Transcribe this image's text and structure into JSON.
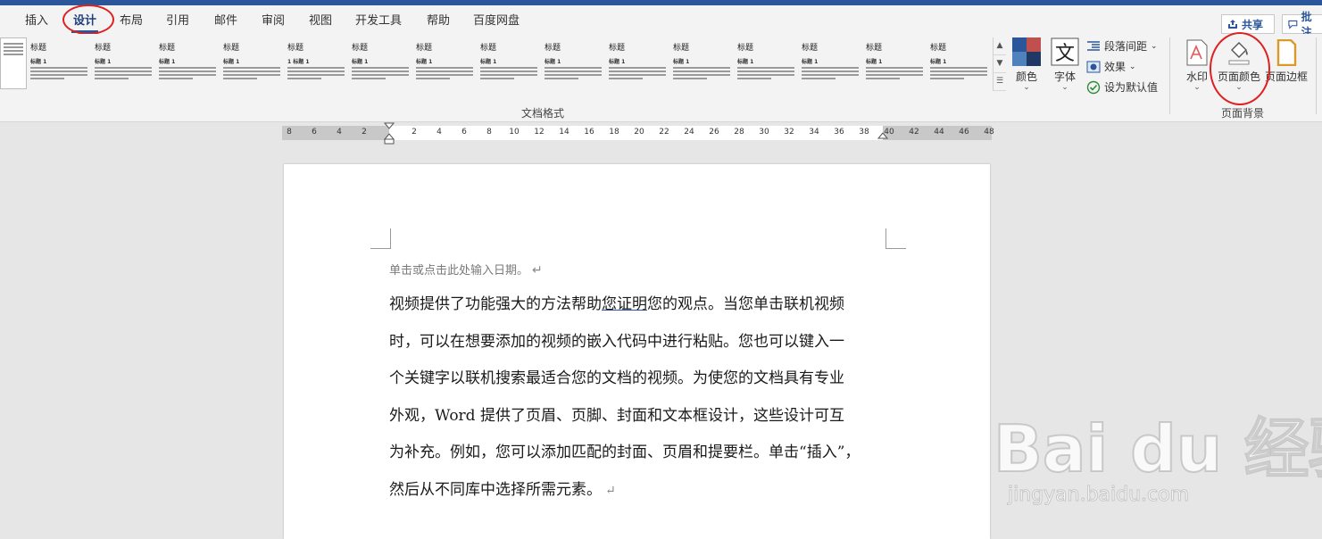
{
  "tabs": [
    "插入",
    "设计",
    "布局",
    "引用",
    "邮件",
    "审阅",
    "视图",
    "开发工具",
    "帮助",
    "百度网盘"
  ],
  "active_tab": "设计",
  "share_label": "共享",
  "comment_label": "批注",
  "gallery": {
    "group_label": "文档格式",
    "thumbs": [
      {
        "title": "标题",
        "heading": "标题 1"
      },
      {
        "title": "标题",
        "heading": "标题 1"
      },
      {
        "title": "标题",
        "heading": "标题 1"
      },
      {
        "title": "标题",
        "heading": "标题 1"
      },
      {
        "title": "标题",
        "heading": "1 标题 1"
      },
      {
        "title": "标题",
        "heading": "标题 1"
      },
      {
        "title": "标题",
        "heading": "标题 1"
      },
      {
        "title": "标题",
        "heading": "标题 1"
      },
      {
        "title": "标题",
        "heading": "标题 1"
      },
      {
        "title": "标题",
        "heading": "标题 1"
      },
      {
        "title": "标题",
        "heading": "标题 1"
      },
      {
        "title": "标题",
        "heading": "标题 1"
      },
      {
        "title": "标题",
        "heading": "标题 1"
      },
      {
        "title": "标题",
        "heading": "标题 1"
      },
      {
        "title": "标题",
        "heading": "标题 1"
      }
    ]
  },
  "colors_label": "颜色",
  "fonts_label": "字体",
  "paragraph_spacing_label": "段落间距",
  "effects_label": "效果",
  "set_default_label": "设为默认值",
  "page_background": {
    "group_label": "页面背景",
    "watermark_label": "水印",
    "page_color_label": "页面颜色",
    "page_border_label": "页面边框"
  },
  "ruler_ticks": [
    "8",
    "6",
    "4",
    "2",
    "2",
    "4",
    "6",
    "8",
    "10",
    "12",
    "14",
    "16",
    "18",
    "20",
    "22",
    "24",
    "26",
    "28",
    "30",
    "32",
    "34",
    "36",
    "38",
    "40",
    "42",
    "44",
    "46",
    "48"
  ],
  "document": {
    "date_placeholder": "单击或点击此处输入日期。",
    "lines": [
      {
        "before": "视频提供了功能强大的方法帮助",
        "underlined": "您证明",
        "after": "您的观点。当您单击联机视频"
      },
      {
        "text": "时，可以在想要添加的视频的嵌入代码中进行粘贴。您也可以键入一"
      },
      {
        "text": "个关键字以联机搜索最适合您的文档的视频。为使您的文档具有专业"
      },
      {
        "text": "外观，Word 提供了页眉、页脚、封面和文本框设计，这些设计可互"
      },
      {
        "text": "为补充。例如，您可以添加匹配的封面、页眉和提要栏。单击“插入”，"
      },
      {
        "text": "然后从不同库中选择所需元素。"
      }
    ]
  },
  "watermark": {
    "logo": "Bai du 经验",
    "url": "jingyan.baidu.com"
  },
  "colors": {
    "accent": "#2b579a",
    "annotation_ring": "#e02020"
  }
}
